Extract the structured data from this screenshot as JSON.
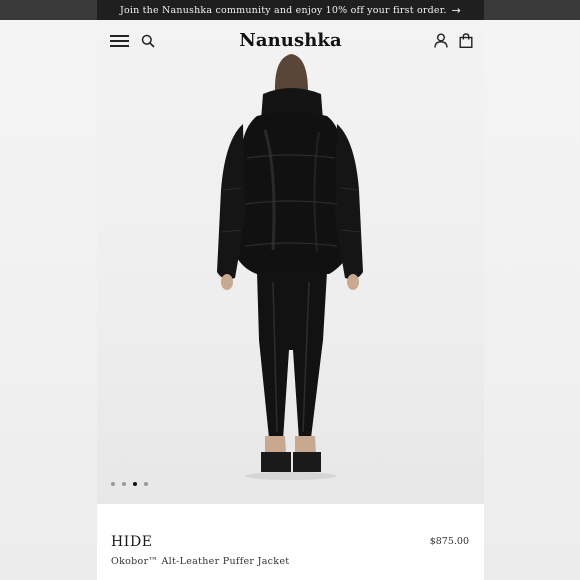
{
  "promo_banner": {
    "text": "Join the Nanushka community and enjoy 10% off your first order.",
    "icon": "arrow-right-icon"
  },
  "header": {
    "logo": "Nanushka",
    "icons": [
      "menu-icon",
      "search-icon",
      "account-icon",
      "shopping-bag-icon"
    ]
  },
  "gallery": {
    "image": "model wearing black alt-leather puffer jacket, back view",
    "slide_count": 4,
    "active_slide": 3
  },
  "product": {
    "brand": "HIDE",
    "name": "Okobor™ Alt-Leather Puffer Jacket",
    "price": "$875.00"
  },
  "colors": {
    "banner_bg": "#1f1f1f",
    "page_bg": "#ffffff",
    "hero_bg": "#eeeeee",
    "text": "#1a1a1a"
  }
}
